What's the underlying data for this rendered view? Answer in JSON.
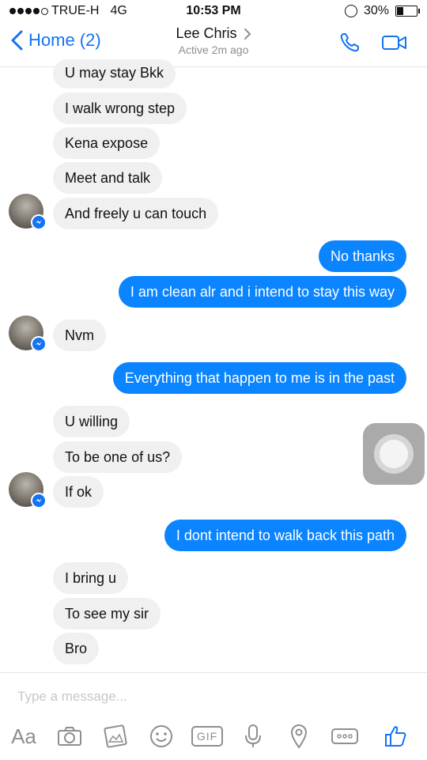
{
  "status_bar": {
    "carrier": "TRUE-H",
    "network": "4G",
    "time": "10:53 PM",
    "battery": "30%"
  },
  "header": {
    "back_label": "Home (2)",
    "contact_name": "Lee Chris",
    "active_status": "Active 2m ago"
  },
  "messages": [
    {
      "text": "U may stay Bkk",
      "side": "in"
    },
    {
      "text": "I walk wrong step",
      "side": "in"
    },
    {
      "text": "Kena expose",
      "side": "in"
    },
    {
      "text": "Meet and talk",
      "side": "in"
    },
    {
      "text": "And freely u can touch",
      "side": "in"
    },
    {
      "text": "No thanks",
      "side": "out"
    },
    {
      "text": "I am clean alr and i intend to stay this way",
      "side": "out"
    },
    {
      "text": "Nvm",
      "side": "in"
    },
    {
      "text": "Everything that happen to me is in the past",
      "side": "out"
    },
    {
      "text": "U willing",
      "side": "in"
    },
    {
      "text": "To be one of us?",
      "side": "in"
    },
    {
      "text": "If ok",
      "side": "in"
    },
    {
      "text": "I dont intend to walk back this path",
      "side": "out"
    },
    {
      "text": "I bring u",
      "side": "in"
    },
    {
      "text": "To see my sir",
      "side": "in"
    },
    {
      "text": "Bro",
      "side": "in"
    }
  ],
  "composer": {
    "placeholder": "Type a message...",
    "tools": [
      "Aa",
      "camera-icon",
      "photo-icon",
      "emoji-icon",
      "GIF",
      "microphone-icon",
      "location-icon",
      "more-icon",
      "like-icon"
    ]
  },
  "colors": {
    "accent": "#1273f4",
    "outgoing_bubble": "#0a84ff",
    "incoming_bubble": "#f0f0f0"
  }
}
